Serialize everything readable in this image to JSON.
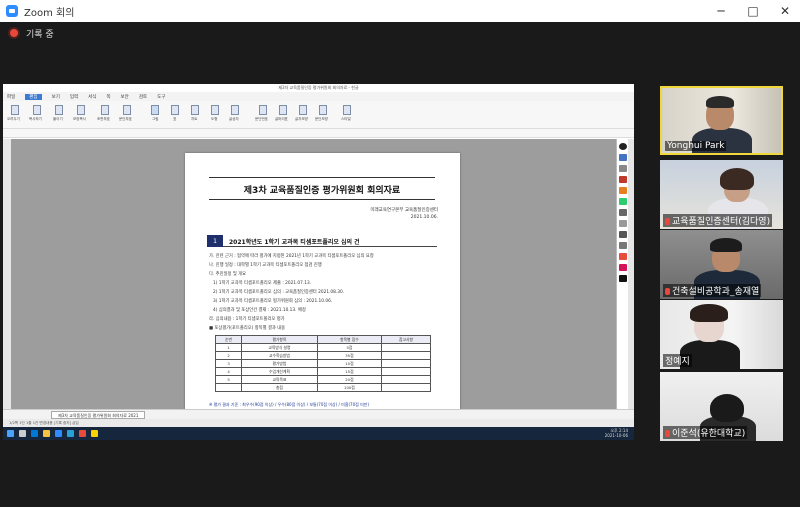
{
  "window": {
    "title": "Zoom 회의",
    "controls": [
      "─",
      "□",
      "✕"
    ]
  },
  "recording": {
    "label": "기록 중",
    "color": "#e8483b"
  },
  "share": {
    "app_title": "제3차 교육품질인증 평가위원회 회의자료 - 한글",
    "menu": [
      "파일",
      "편집",
      "보기",
      "입력",
      "서식",
      "쪽",
      "보안",
      "검토",
      "도구"
    ],
    "menu_selected": "편집",
    "ribbon": [
      "오려두기",
      "복사하기",
      "붙이기",
      "모양복사",
      "조판부호",
      "문단부호",
      "그림",
      "표",
      "차트",
      "도형",
      "글상자",
      "문단번호",
      "글머리표",
      "글자모양",
      "문단모양",
      "스타일",
      "찾기",
      "바꾸기"
    ],
    "document": {
      "title": "제3차 교육품질인증 평가위원회 회의자료",
      "org": "미래교육연구본부 교육품질인증센터",
      "date": "2021.10.06.",
      "section_num": "1",
      "section_title": "2021학년도 1학기 교과목 티셈포트폴리오 심의 건",
      "lines": [
        "가. 관련 근거 : 협약에 따라 평가에 지정된 2021년 1학기 교과목 티셈포트폴리오 심의 요청",
        "나. 진행 일정 : 대학별 1학기 교과목 티셈포트폴리오 점검 진행",
        "다. 추진일정 및 개요",
        "1) 1학기 교과목 티셈포트폴리오 제출 : 2021.07.13.",
        "2) 1학기 교과목 티셈포트폴리오 심의 : 교육품질인증센터 2021.08.30.",
        "3) 1학기 교과목 티셈포트폴리오 평가위원회 심의 : 2021.10.06.",
        "4) 심의결과 및 포상안건 결재 : 2021.10.13. 예정",
        "라. 심의내용 : 1학기 티셈포트폴리오 평가",
        "■ 포상평가(포트폴리오) 항목별 결과 내용"
      ],
      "table_headers": [
        "순번",
        "평가항목",
        "항목별 점수",
        "참고사항"
      ],
      "table_rows": [
        [
          "1",
          "교육방식 설명",
          "5점",
          ""
        ],
        [
          "2",
          "교수학습방법",
          "35점",
          ""
        ],
        [
          "3",
          "평가방법",
          "10점",
          ""
        ],
        [
          "4",
          "수업개선계획",
          "15점",
          ""
        ],
        [
          "5",
          "교육목표",
          "20점",
          ""
        ],
        [
          "",
          "총점",
          "100점",
          ""
        ]
      ],
      "note": "※ 평가 결과 기준 : 최우수(90점 이상) / 우수(80점 이상) / 보통(70점 이상) / 미흡(70점 미만)"
    },
    "doc_tab": "제3차 교육품질인증 평가위원회 회의자료 2021",
    "status": "1/2쪽  1단  1줄  1칸  변경내용 [기록 중지]  삽입",
    "clock": {
      "time": "오후 2:14",
      "date": "2021-10-06"
    }
  },
  "participants": [
    {
      "name": "Yonghui Park",
      "muted": false,
      "active": true
    },
    {
      "name": "교육품질인증센터(김다영)",
      "muted": true,
      "active": false
    },
    {
      "name": "건축설비공학과_송재열",
      "muted": true,
      "active": false
    },
    {
      "name": "정예지",
      "muted": false,
      "active": false
    },
    {
      "name": "이준석(유한대학교)",
      "muted": true,
      "active": false
    }
  ]
}
